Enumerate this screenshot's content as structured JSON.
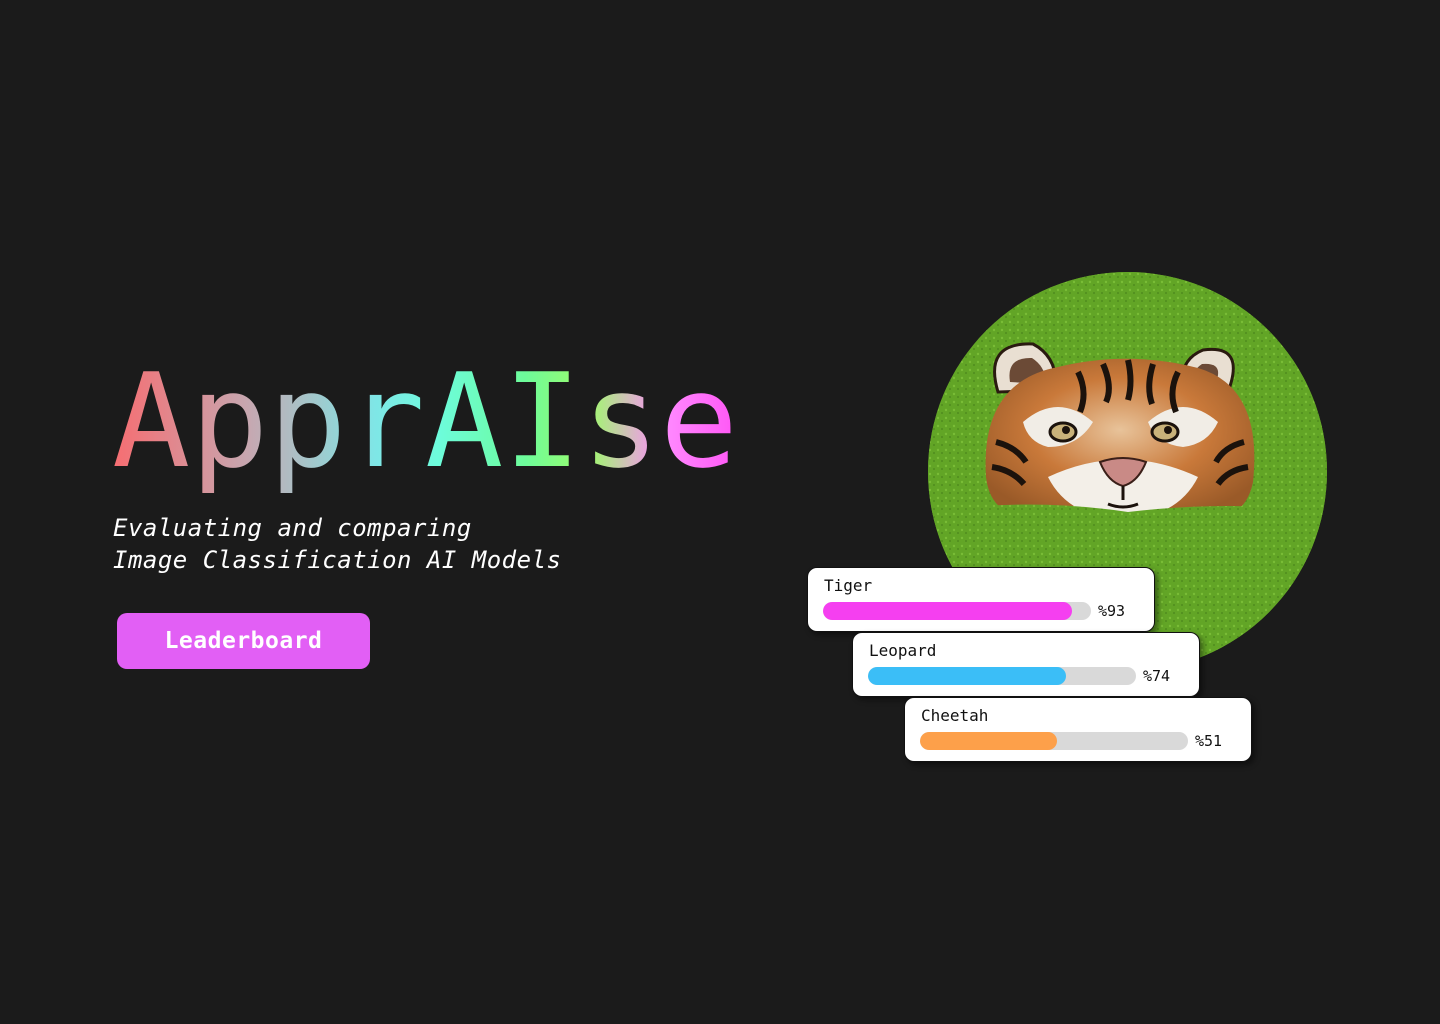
{
  "brand": {
    "logo_text": "ApprAIse"
  },
  "tagline": {
    "line1": "Evaluating and comparing",
    "line2": "Image Classification AI Models"
  },
  "cta": {
    "label": "Leaderboard",
    "color": "#e25ff5"
  },
  "hero_image": {
    "subject": "tiger-in-algae-pond"
  },
  "predictions": [
    {
      "label": "Tiger",
      "value": 93,
      "display": "%93",
      "color": "#f53ff0"
    },
    {
      "label": "Leopard",
      "value": 74,
      "display": "%74",
      "color": "#3bbef7"
    },
    {
      "label": "Cheetah",
      "value": 51,
      "display": "%51",
      "color": "#fda04a"
    }
  ]
}
